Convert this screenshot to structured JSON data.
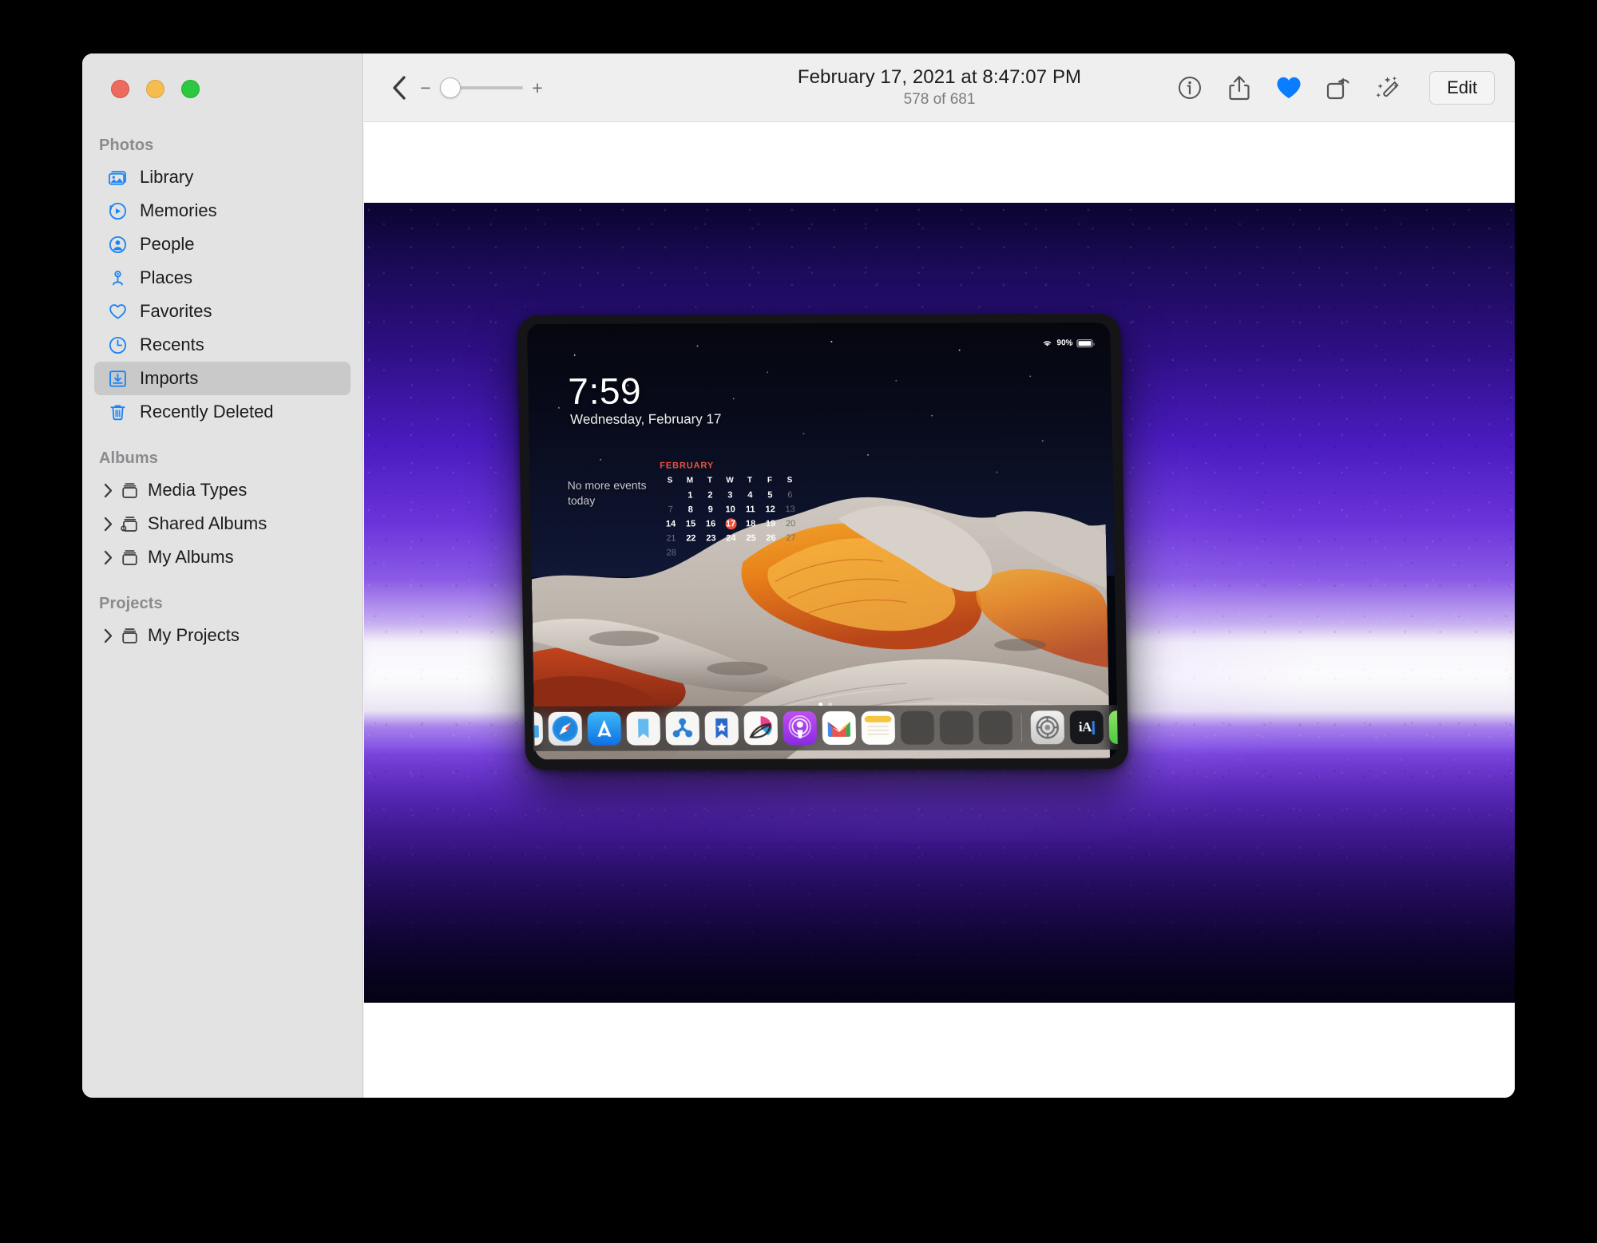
{
  "window": {
    "traffic_lights": [
      {
        "name": "close",
        "color": "#ED6A5E"
      },
      {
        "name": "minimize",
        "color": "#F5BD4F"
      },
      {
        "name": "zoom",
        "color": "#2BC840"
      }
    ]
  },
  "sidebar": {
    "groups": [
      {
        "title": "Photos",
        "items": [
          {
            "label": "Library",
            "icon": "library-icon",
            "selected": false,
            "disclosure": false
          },
          {
            "label": "Memories",
            "icon": "memories-icon",
            "selected": false,
            "disclosure": false
          },
          {
            "label": "People",
            "icon": "people-icon",
            "selected": false,
            "disclosure": false
          },
          {
            "label": "Places",
            "icon": "places-icon",
            "selected": false,
            "disclosure": false
          },
          {
            "label": "Favorites",
            "icon": "heart-icon",
            "selected": false,
            "disclosure": false
          },
          {
            "label": "Recents",
            "icon": "clock-icon",
            "selected": false,
            "disclosure": false
          },
          {
            "label": "Imports",
            "icon": "import-icon",
            "selected": true,
            "disclosure": false
          },
          {
            "label": "Recently Deleted",
            "icon": "trash-icon",
            "selected": false,
            "disclosure": false
          }
        ]
      },
      {
        "title": "Albums",
        "items": [
          {
            "label": "Media Types",
            "icon": "album-icon",
            "selected": false,
            "disclosure": true
          },
          {
            "label": "Shared Albums",
            "icon": "shared-album-icon",
            "selected": false,
            "disclosure": true
          },
          {
            "label": "My Albums",
            "icon": "album-icon",
            "selected": false,
            "disclosure": true
          }
        ]
      },
      {
        "title": "Projects",
        "items": [
          {
            "label": "My Projects",
            "icon": "album-icon",
            "selected": false,
            "disclosure": true
          }
        ]
      }
    ]
  },
  "toolbar": {
    "back_icon": "chevron-left-icon",
    "zoom_out_label": "−",
    "zoom_in_label": "+",
    "zoom_value": 0,
    "date_title": "February 17, 2021 at 8:47:07 PM",
    "count_subtitle": "578 of 681",
    "actions": [
      {
        "name": "info-icon",
        "label": "Info"
      },
      {
        "name": "share-icon",
        "label": "Share"
      },
      {
        "name": "heart-icon",
        "label": "Favorite",
        "active": true,
        "color": "#0A7CFF"
      },
      {
        "name": "rotate-icon",
        "label": "Rotate"
      },
      {
        "name": "magic-wand-icon",
        "label": "Auto Enhance"
      }
    ],
    "edit_label": "Edit"
  },
  "photo": {
    "description": "Tilted iPad Pro on a purple-lit wall showing the lock screen",
    "background_colors": {
      "wall_deep": "#2D0F82",
      "wall_mid": "#6A34DA",
      "wall_light_band": "#F3F0F8",
      "floor": "#5A22C9",
      "shadow": "#0C0430"
    },
    "device": {
      "lock_screen": {
        "time": "7:59",
        "date": "Wednesday, February 17",
        "events_text": "No more events today",
        "status": {
          "wifi_icon": "wifi-icon",
          "battery_percent": "90%",
          "battery_level": 90
        },
        "calendar": {
          "month": "FEBRUARY",
          "weekday_headers": [
            "S",
            "M",
            "T",
            "W",
            "T",
            "F",
            "S"
          ],
          "today": 17,
          "weeks": [
            [
              null,
              1,
              2,
              3,
              4,
              5,
              6
            ],
            [
              7,
              8,
              9,
              10,
              11,
              12,
              13
            ],
            [
              14,
              15,
              16,
              17,
              18,
              19,
              20
            ],
            [
              21,
              22,
              23,
              24,
              25,
              26,
              27
            ],
            [
              28,
              null,
              null,
              null,
              null,
              null,
              null
            ]
          ],
          "dim_days": [
            6,
            7,
            13,
            20,
            21,
            27,
            28
          ]
        },
        "page_dots": {
          "count": 2,
          "active": 0
        },
        "dock": [
          {
            "name": "files-app-icon",
            "label": "Files"
          },
          {
            "name": "safari-app-icon",
            "label": "Safari"
          },
          {
            "name": "app-store-icon",
            "label": "App Store"
          },
          {
            "name": "bookmark-app-icon",
            "label": "Bookmark"
          },
          {
            "name": "branch-app-icon",
            "label": "Branch"
          },
          {
            "name": "star-bookmark-icon",
            "label": "Star Bookmark"
          },
          {
            "name": "leaf-app-icon",
            "label": "Leaf"
          },
          {
            "name": "podcasts-app-icon",
            "label": "Podcasts"
          },
          {
            "name": "gmail-app-icon",
            "label": "Gmail"
          },
          {
            "name": "notes-app-icon",
            "label": "Notes"
          },
          {
            "name": "app-stack-1-icon",
            "label": "App Stack"
          },
          {
            "name": "app-stack-2-icon",
            "label": "App Stack"
          },
          {
            "name": "app-stack-3-icon",
            "label": "App Stack"
          },
          {
            "name": "separator",
            "label": "Separator"
          },
          {
            "name": "settings-app-icon",
            "label": "Settings"
          },
          {
            "name": "ia-writer-app-icon",
            "label": "iA Writer"
          },
          {
            "name": "find-my-app-icon",
            "label": "Find My"
          }
        ]
      },
      "wallpaper": {
        "name": "Big Sur White Pocket",
        "sky_color": "#080B1B",
        "rock_light": "#D9D4CE",
        "rock_orange": "#E8871F",
        "rock_red": "#B5371A"
      }
    }
  }
}
